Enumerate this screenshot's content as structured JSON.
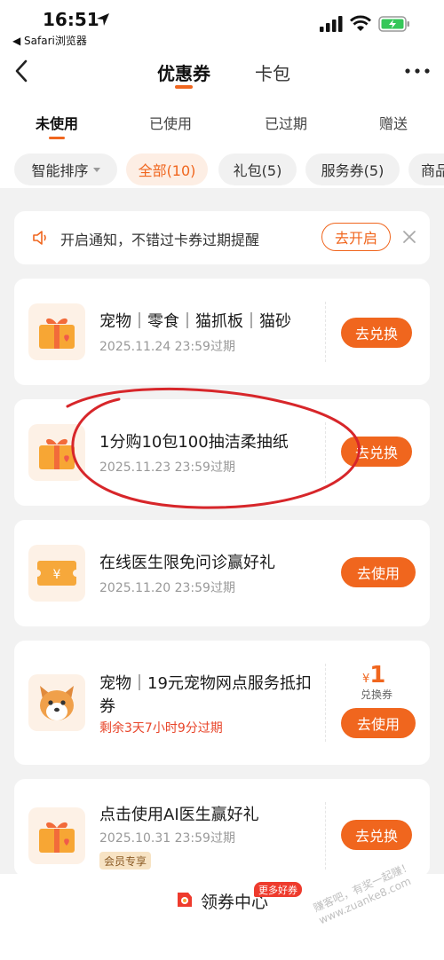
{
  "status_bar": {
    "time": "16:51",
    "back_app": "◀ Safari浏览器"
  },
  "nav": {
    "tabs": [
      "优惠券",
      "卡包"
    ]
  },
  "status_tabs": [
    "未使用",
    "已使用",
    "已过期",
    "赠送"
  ],
  "filters": [
    {
      "label": "智能排序",
      "dropdown": true
    },
    {
      "label": "全部(10)",
      "active": true
    },
    {
      "label": "礼包(5)"
    },
    {
      "label": "服务券(5)"
    },
    {
      "label": "商品"
    }
  ],
  "notice": {
    "text": "开启通知，不错过卡券过期提醒",
    "button": "去开启"
  },
  "coupons": [
    {
      "title": "宠物｜零食｜猫抓板｜猫砂",
      "subtitle": "2025.11.24 23:59过期",
      "button": "去兑换",
      "icon": "gift-box-icon"
    },
    {
      "title": "1分购10包100抽洁柔抽纸",
      "subtitle": "2025.11.23 23:59过期",
      "button": "去兑换",
      "icon": "gift-box-icon"
    },
    {
      "title": "在线医生限免问诊赢好礼",
      "subtitle": "2025.11.20 23:59过期",
      "button": "去使用",
      "icon": "coupon-ticket-icon"
    },
    {
      "title": "宠物｜19元宠物网点服务抵扣券",
      "subtitle": "剩余3天7小时9分过期",
      "button": "去使用",
      "icon": "dog-face-icon",
      "price_symbol": "¥",
      "price_value": "1",
      "price_note": "兑换券"
    },
    {
      "title": "点击使用AI医生赢好礼",
      "subtitle": "2025.10.31 23:59过期",
      "button": "去兑换",
      "icon": "gift-box-icon",
      "badge": "会员专享"
    }
  ],
  "bottom": {
    "label": "领券中心",
    "badge": "更多好券"
  },
  "watermark": "赚客吧，有奖一起赚！www.zuanke8.com",
  "colors": {
    "accent": "#f0661e",
    "warning_red": "#e8452a",
    "annotation_red": "#d7262a"
  }
}
